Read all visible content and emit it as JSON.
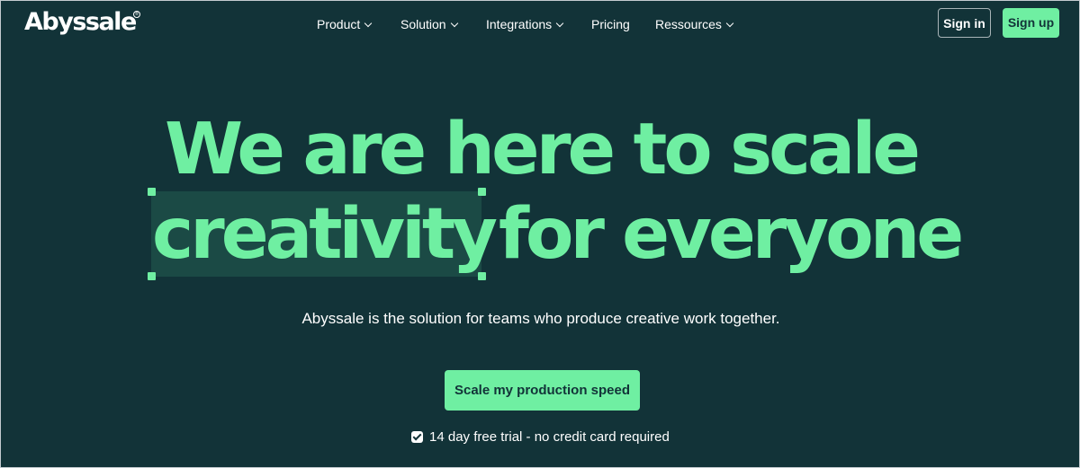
{
  "brand": {
    "name": "Abyssale",
    "registered_mark": "®"
  },
  "nav": {
    "items": [
      {
        "label": "Product",
        "has_dropdown": true
      },
      {
        "label": "Solution",
        "has_dropdown": true
      },
      {
        "label": "Integrations",
        "has_dropdown": true
      },
      {
        "label": "Pricing",
        "has_dropdown": false
      },
      {
        "label": "Ressources",
        "has_dropdown": true
      }
    ],
    "sign_in_label": "Sign in",
    "sign_up_label": "Sign up"
  },
  "hero": {
    "line1": "We are here to scale",
    "highlighted_word": "creativity",
    "line2_rest": "for everyone",
    "subtitle": "Abyssale is the solution for teams who produce creative work together.",
    "cta_label": "Scale my production speed",
    "trial_note": "14 day free trial - no credit card required"
  },
  "colors": {
    "background": "#123338",
    "accent": "#6fefa2",
    "highlight": "#1b4a45",
    "text": "#ffffff"
  }
}
